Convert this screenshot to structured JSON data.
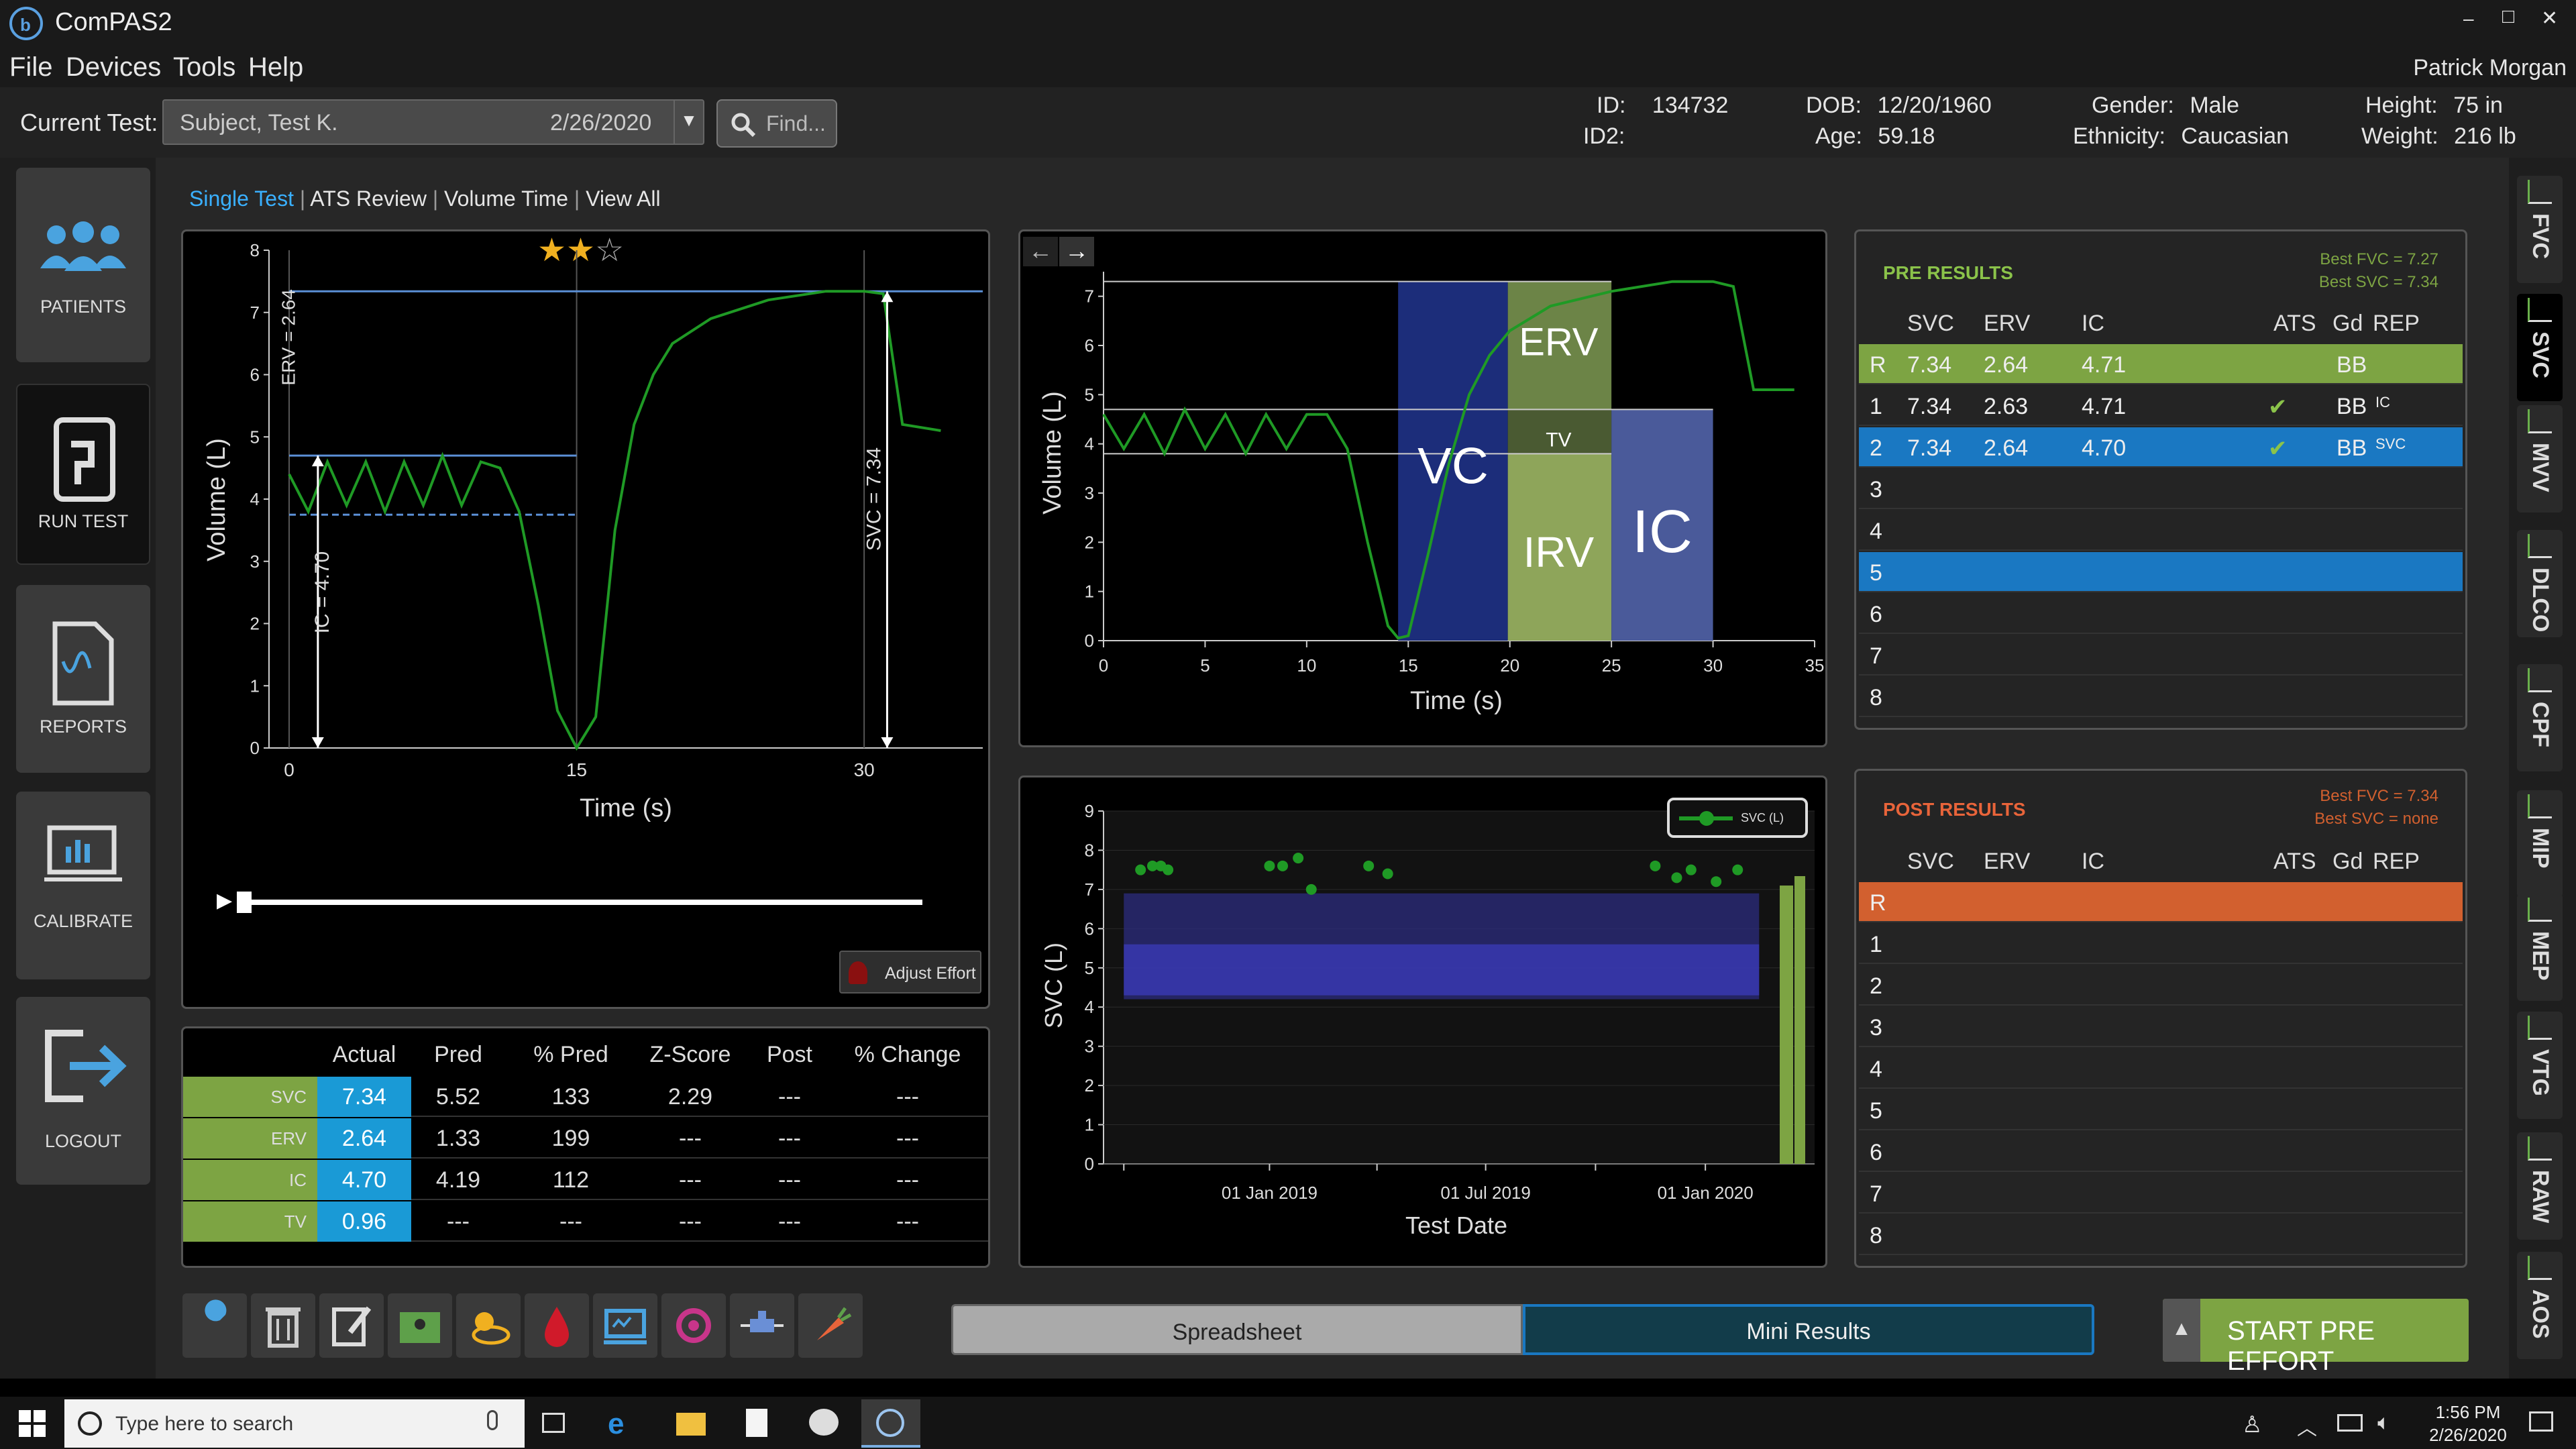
{
  "app": {
    "title": "ComPAS2",
    "user": "Patrick Morgan"
  },
  "window_controls": {
    "minimize": "‒",
    "restore": "□",
    "close": "✕"
  },
  "menu": [
    "File",
    "Devices",
    "Tools",
    "Help"
  ],
  "current_test": {
    "label": "Current Test:",
    "subject": "Subject, Test K.",
    "date": "2/26/2020",
    "find": "Find..."
  },
  "patient": {
    "id_label": "ID:",
    "id": "134732",
    "id2_label": "ID2:",
    "dob_label": "DOB:",
    "dob": "12/20/1960",
    "age_label": "Age:",
    "age": "59.18",
    "gender_label": "Gender:",
    "gender": "Male",
    "ethnicity_label": "Ethnicity:",
    "ethnicity": "Caucasian",
    "height_label": "Height:",
    "height": "75 in",
    "weight_label": "Weight:",
    "weight": "216 lb"
  },
  "nav": [
    {
      "label": "PATIENTS",
      "icon": "patients-icon"
    },
    {
      "label": "RUN TEST",
      "icon": "run-test-icon"
    },
    {
      "label": "REPORTS",
      "icon": "reports-icon"
    },
    {
      "label": "CALIBRATE",
      "icon": "calibrate-icon"
    },
    {
      "label": "LOGOUT",
      "icon": "logout-icon"
    }
  ],
  "view_tabs": [
    "Single Test",
    "ATS Review",
    "Volume Time",
    "View All"
  ],
  "right_tabs": [
    "FVC",
    "SVC",
    "MVV",
    "DLCO",
    "CPF",
    "MIP",
    "MEP",
    "VTG",
    "RAW",
    "AOS"
  ],
  "rating": {
    "value": 2,
    "max": 3
  },
  "adjust_effort": "Adjust Effort",
  "chart_data": [
    {
      "type": "line",
      "title": "",
      "xlabel": "Time (s)",
      "ylabel": "Volume (L)",
      "xlim": [
        0,
        35
      ],
      "ylim": [
        0,
        8
      ],
      "x_ticks": [
        "0",
        "15",
        "30"
      ],
      "y_ticks": [
        "0",
        "1",
        "2",
        "3",
        "4",
        "5",
        "6",
        "7",
        "8"
      ],
      "series": [
        {
          "x": [
            0,
            1,
            2,
            3,
            4,
            5,
            6,
            7,
            8,
            9,
            10,
            11,
            12,
            13,
            14,
            15,
            16,
            17,
            18,
            19,
            20,
            22,
            25,
            28,
            30,
            31,
            32,
            34
          ],
          "y": [
            4.4,
            3.8,
            4.6,
            3.9,
            4.6,
            3.8,
            4.6,
            3.9,
            4.7,
            3.9,
            4.6,
            4.5,
            3.8,
            2.3,
            0.6,
            0,
            0.5,
            3.5,
            5.2,
            6.0,
            6.5,
            6.9,
            7.2,
            7.34,
            7.34,
            7.3,
            5.2,
            5.1
          ]
        }
      ],
      "annotations": [
        "ERV = 2.64",
        "IC = 4.70",
        "SVC = 7.34"
      ]
    },
    {
      "type": "line",
      "title": "",
      "xlabel": "Time (s)",
      "ylabel": "Volume (L)",
      "xlim": [
        0,
        35
      ],
      "ylim": [
        0,
        7.5
      ],
      "x_ticks": [
        "0",
        "5",
        "10",
        "15",
        "20",
        "25",
        "30",
        "35"
      ],
      "y_ticks": [
        "0",
        "1",
        "2",
        "3",
        "4",
        "5",
        "6",
        "7"
      ],
      "series": [
        {
          "x": [
            0,
            1,
            2,
            3,
            4,
            5,
            6,
            7,
            8,
            9,
            10,
            11,
            12,
            13,
            14,
            14.5,
            15,
            16,
            17,
            18,
            19,
            20,
            22,
            25,
            28,
            30,
            31,
            32,
            34
          ],
          "y": [
            4.6,
            3.9,
            4.6,
            3.8,
            4.7,
            3.9,
            4.6,
            3.8,
            4.6,
            3.9,
            4.6,
            4.6,
            3.9,
            2.0,
            0.3,
            0.05,
            0.1,
            1.8,
            3.6,
            5.0,
            5.8,
            6.3,
            6.8,
            7.1,
            7.3,
            7.3,
            7.2,
            5.1,
            5.1
          ]
        }
      ],
      "regions": [
        "VC",
        "ERV",
        "TV",
        "IRV",
        "IC"
      ]
    },
    {
      "type": "scatter",
      "title": "",
      "xlabel": "Test Date",
      "ylabel": "SVC (L)",
      "ylim": [
        0,
        9
      ],
      "x_ticks": [
        "01 Jan 2019",
        "01 Jul 2019",
        "01 Jan 2020"
      ],
      "y_ticks": [
        "0",
        "1",
        "2",
        "3",
        "4",
        "5",
        "6",
        "7",
        "8",
        "9"
      ],
      "legend": {
        "label": "SVC (L)",
        "placement": "top-right"
      },
      "series": [
        {
          "name": "SVC (L)",
          "x": [
            "2018-09-15",
            "2018-09-25",
            "2018-10-02",
            "2018-10-08",
            "2019-01-01",
            "2019-01-12",
            "2019-01-25",
            "2019-02-05",
            "2019-03-25",
            "2019-04-10",
            "2019-11-20",
            "2019-12-08",
            "2019-12-20",
            "2020-01-10",
            "2020-01-28"
          ],
          "y": [
            7.5,
            7.6,
            7.6,
            7.5,
            7.6,
            7.6,
            7.8,
            7.0,
            7.6,
            7.4,
            7.6,
            7.3,
            7.5,
            7.2,
            7.5
          ]
        }
      ]
    }
  ],
  "results_table": {
    "headers": [
      "",
      "Actual",
      "Pred",
      "% Pred",
      "Z-Score",
      "Post",
      "% Change"
    ],
    "rows": [
      [
        "SVC",
        "7.34",
        "5.52",
        "133",
        "2.29",
        "---",
        "---"
      ],
      [
        "ERV",
        "2.64",
        "1.33",
        "199",
        "---",
        "---",
        "---"
      ],
      [
        "IC",
        "4.70",
        "4.19",
        "112",
        "---",
        "---",
        "---"
      ],
      [
        "TV",
        "0.96",
        "---",
        "---",
        "---",
        "---",
        "---"
      ]
    ]
  },
  "pre_results": {
    "title": "PRE RESULTS",
    "best_fvc": "Best FVC = 7.27",
    "best_svc": "Best SVC = 7.34",
    "headers": [
      "SVC",
      "ERV",
      "IC",
      "ATS",
      "Gd",
      "REP"
    ],
    "rows": [
      {
        "n": "R",
        "svc": "7.34",
        "erv": "2.64",
        "ic": "4.71",
        "ats": "",
        "gd": "BB",
        "rep": ""
      },
      {
        "n": "1",
        "svc": "7.34",
        "erv": "2.63",
        "ic": "4.71",
        "ats": "✔",
        "gd": "BB",
        "rep": "IC"
      },
      {
        "n": "2",
        "svc": "7.34",
        "erv": "2.64",
        "ic": "4.70",
        "ats": "✔",
        "gd": "BB",
        "rep": "SVC"
      },
      {
        "n": "3",
        "svc": "",
        "erv": "",
        "ic": "",
        "ats": "",
        "gd": "",
        "rep": ""
      },
      {
        "n": "4",
        "svc": "",
        "erv": "",
        "ic": "",
        "ats": "",
        "gd": "",
        "rep": ""
      },
      {
        "n": "5",
        "svc": "",
        "erv": "",
        "ic": "",
        "ats": "",
        "gd": "",
        "rep": ""
      },
      {
        "n": "6",
        "svc": "",
        "erv": "",
        "ic": "",
        "ats": "",
        "gd": "",
        "rep": ""
      },
      {
        "n": "7",
        "svc": "",
        "erv": "",
        "ic": "",
        "ats": "",
        "gd": "",
        "rep": ""
      },
      {
        "n": "8",
        "svc": "",
        "erv": "",
        "ic": "",
        "ats": "",
        "gd": "",
        "rep": ""
      }
    ]
  },
  "post_results": {
    "title": "POST RESULTS",
    "best_fvc": "Best FVC = 7.34",
    "best_svc": "Best SVC = none",
    "headers": [
      "SVC",
      "ERV",
      "IC",
      "ATS",
      "Gd",
      "REP"
    ],
    "rows": [
      "R",
      "1",
      "2",
      "3",
      "4",
      "5",
      "6",
      "7",
      "8"
    ]
  },
  "bottom_tabs": {
    "spreadsheet": "Spreadsheet",
    "mini_results": "Mini Results"
  },
  "start_button": "START PRE EFFORT",
  "taskbar": {
    "search_placeholder": "Type here to search",
    "time": "1:56 PM",
    "date": "2/26/2020"
  },
  "colors": {
    "accent_blue": "#1a78c2",
    "green": "#7da443",
    "orange": "#d2602f",
    "chart_line": "#1f9a25"
  }
}
